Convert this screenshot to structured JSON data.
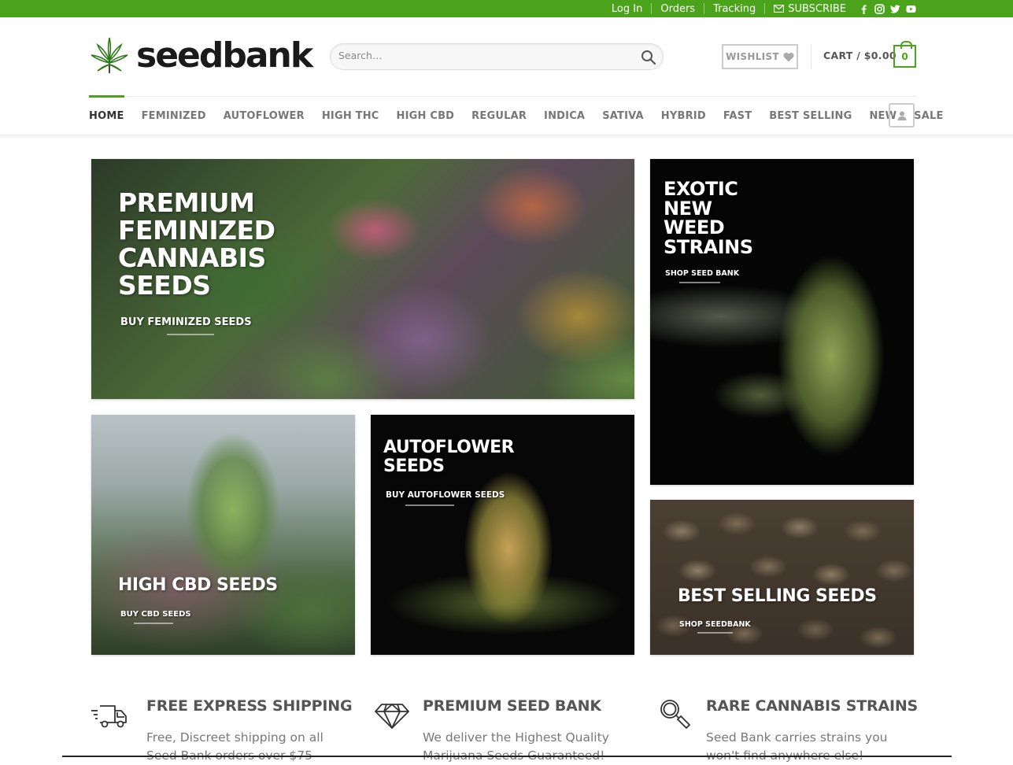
{
  "topbar": {
    "login": "Log In",
    "orders": "Orders",
    "tracking": "Tracking",
    "subscribe": "SUBSCRIBE"
  },
  "header": {
    "logo_text": "seedbank",
    "search_placeholder": "Search…",
    "wishlist": "WISHLIST",
    "cart": "CART / $0.00",
    "cart_count": "0"
  },
  "nav": {
    "items": [
      "HOME",
      "FEMINIZED",
      "AUTOFLOWER",
      "HIGH THC",
      "HIGH CBD",
      "REGULAR",
      "INDICA",
      "SATIVA",
      "HYBRID",
      "FAST",
      "BEST SELLING",
      "NEW",
      "SALE"
    ]
  },
  "banners": {
    "feminized": {
      "title_lines": [
        "PREMIUM",
        "FEMINIZED",
        "CANNABIS",
        "SEEDS"
      ],
      "cta": "BUY FEMINIZED SEEDS"
    },
    "exotic": {
      "title_lines": [
        "EXOTIC",
        "NEW",
        "WEED",
        "STRAINS"
      ],
      "cta": "SHOP SEED BANK"
    },
    "cbd": {
      "title": "HIGH CBD SEEDS",
      "cta": "BUY CBD SEEDS"
    },
    "autoflower": {
      "title_lines": [
        "AUTOFLOWER",
        "SEEDS"
      ],
      "cta": "BUY AUTOFLOWER SEEDS"
    },
    "best": {
      "title": "BEST SELLING SEEDS",
      "cta": "SHOP SEEDBANK"
    }
  },
  "features": [
    {
      "title": "FREE EXPRESS SHIPPING",
      "text": "Free, Discreet shipping on all Seed Bank orders over $75",
      "icon": "truck-icon"
    },
    {
      "title": "PREMIUM SEED BANK",
      "text": "We deliver the Highest Quality Marijuana Seeds Guaranteed!",
      "icon": "diamond-icon"
    },
    {
      "title": "RARE CANNABIS STRAINS",
      "text": "Seed Bank carries strains you won't find anywhere else!",
      "icon": "magnifier-icon"
    }
  ],
  "colors": {
    "accent": "#4aa31a"
  }
}
